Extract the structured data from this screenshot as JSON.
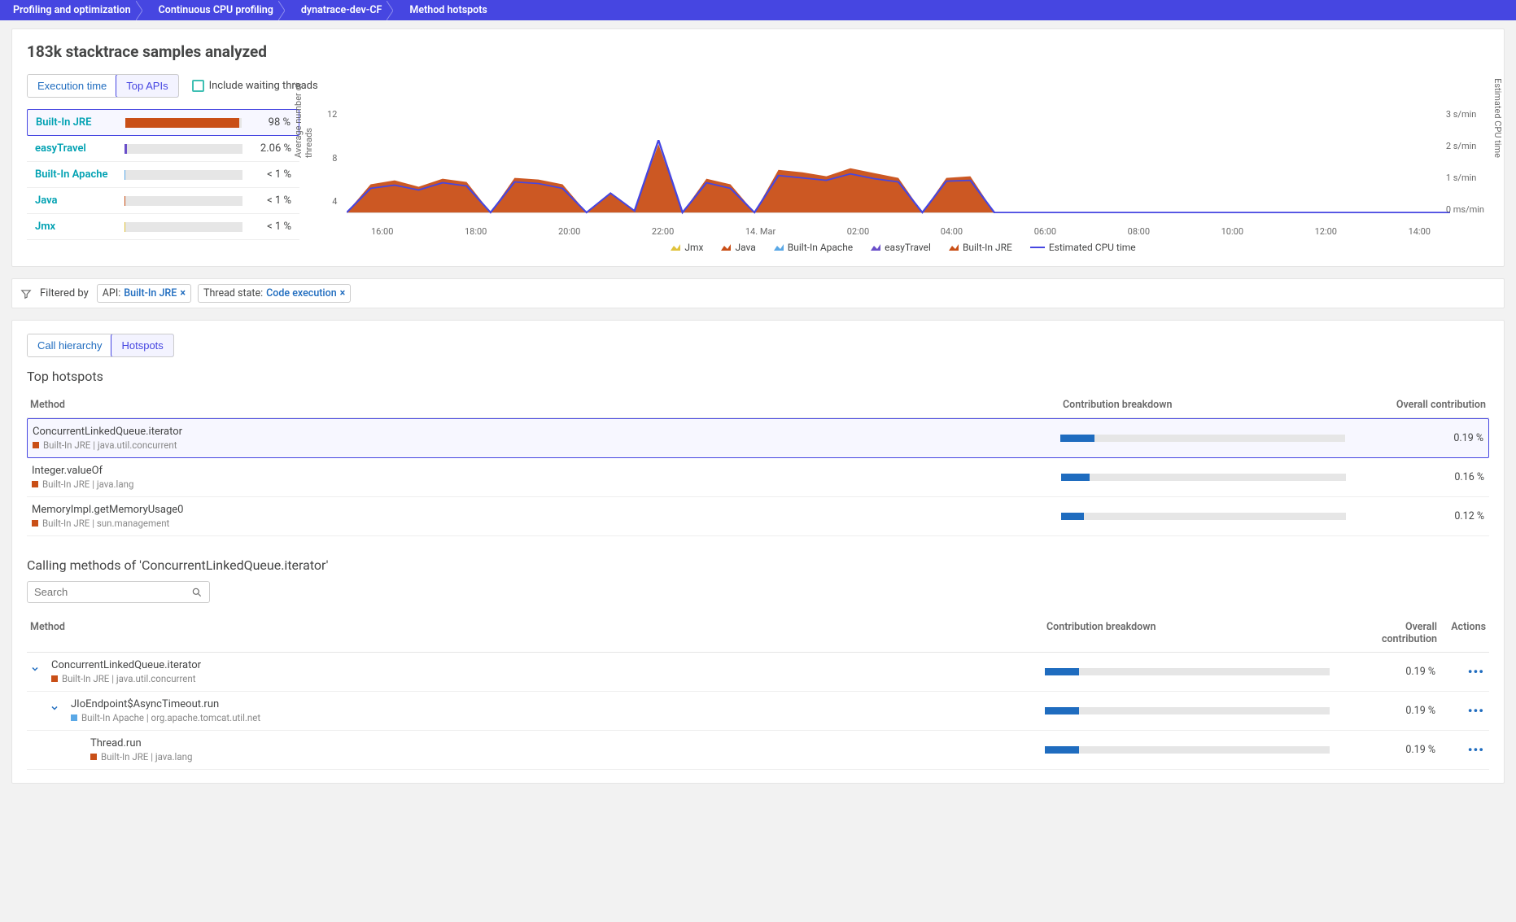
{
  "breadcrumb": {
    "items": [
      "Profiling and optimization",
      "Continuous CPU profiling",
      "dynatrace-dev-CF",
      "Method hotspots"
    ]
  },
  "headline": "183k stacktrace samples analyzed",
  "view_tabs": {
    "execution_time": "Execution time",
    "top_apis": "Top APIs"
  },
  "include_waiting_label": "Include waiting threads",
  "api_rows": [
    {
      "name": "Built-In JRE",
      "pct": "98 %",
      "width": 98,
      "color": "#c94f17"
    },
    {
      "name": "easyTravel",
      "pct": "2.06 %",
      "width": 2.06,
      "color": "#6a4fc9"
    },
    {
      "name": "Built-In Apache",
      "pct": "< 1 %",
      "width": 0.5,
      "color": "#5aa8e6"
    },
    {
      "name": "Java",
      "pct": "< 1 %",
      "width": 0.3,
      "color": "#c94f17"
    },
    {
      "name": "Jmx",
      "pct": "< 1 %",
      "width": 0.2,
      "color": "#e0c23b"
    }
  ],
  "chart_data": {
    "type": "area",
    "xlabel": "",
    "x_ticks": [
      "16:00",
      "18:00",
      "20:00",
      "22:00",
      "14. Mar",
      "02:00",
      "04:00",
      "06:00",
      "08:00",
      "10:00",
      "12:00",
      "14:00"
    ],
    "y_left_label": "Average number of\nthreads",
    "y_left_ticks": [
      "12",
      "8",
      "4"
    ],
    "y_right_label": "Estimated CPU time",
    "y_right_ticks": [
      "3 s/min",
      "2 s/min",
      "1 s/min",
      "0 ms/min"
    ],
    "series": [
      {
        "name": "Built-In JRE",
        "color": "#c94f17",
        "values": [
          0,
          3.5,
          4,
          3.2,
          4.2,
          3.8,
          0,
          4.3,
          4.1,
          3.5,
          0,
          2.5,
          0.3,
          8.5,
          0,
          4.2,
          3.5,
          0,
          5.3,
          5.0,
          4.5,
          5.5,
          4.9,
          4.3,
          0,
          4.3,
          4.5,
          0,
          0,
          0,
          0,
          0,
          0,
          0,
          0,
          0,
          0,
          0,
          0,
          0,
          0,
          0,
          0,
          0,
          0,
          0,
          0
        ]
      },
      {
        "name": "Estimated CPU time",
        "color": "#4646e1",
        "type": "line",
        "values": [
          0,
          3.0,
          3.4,
          2.8,
          3.7,
          3.3,
          0,
          3.8,
          3.6,
          3.0,
          0,
          2.4,
          0.2,
          9.0,
          0,
          3.7,
          3.0,
          0,
          4.6,
          4.3,
          4.0,
          4.8,
          4.2,
          3.8,
          0,
          3.9,
          4.0,
          0,
          0,
          0,
          0,
          0,
          0,
          0,
          0,
          0,
          0,
          0,
          0,
          0,
          0,
          0,
          0,
          0,
          0,
          0,
          0
        ]
      }
    ],
    "legend": [
      {
        "label": "Jmx",
        "color": "#e0c23b"
      },
      {
        "label": "Java",
        "color": "#c94f17"
      },
      {
        "label": "Built-In Apache",
        "color": "#5aa8e6"
      },
      {
        "label": "easyTravel",
        "color": "#6a4fc9"
      },
      {
        "label": "Built-In JRE",
        "color": "#c94f17"
      },
      {
        "label": "Estimated CPU time",
        "color": "#4646e1",
        "shape": "line"
      }
    ]
  },
  "filter_bar": {
    "label": "Filtered by",
    "chips": [
      {
        "key": "API:",
        "value": "Built-In JRE"
      },
      {
        "key": "Thread state:",
        "value": "Code execution"
      }
    ]
  },
  "lower_tabs": {
    "call_hierarchy": "Call hierarchy",
    "hotspots": "Hotspots"
  },
  "hotspots": {
    "title": "Top hotspots",
    "cols": {
      "method": "Method",
      "breakdown": "Contribution breakdown",
      "overall": "Overall contribution"
    },
    "rows": [
      {
        "name": "ConcurrentLinkedQueue.iterator",
        "sub": "Built-In JRE | java.util.concurrent",
        "sq": "#c94f17",
        "fill": 12,
        "fillColor": "#1f6cbf",
        "pct": "0.19 %",
        "selected": true
      },
      {
        "name": "Integer.valueOf",
        "sub": "Built-In JRE | java.lang",
        "sq": "#c94f17",
        "fill": 10,
        "fillColor": "#1f6cbf",
        "pct": "0.16 %"
      },
      {
        "name": "MemoryImpl.getMemoryUsage0",
        "sub": "Built-In JRE | sun.management",
        "sq": "#c94f17",
        "fill": 8,
        "fillColor": "#1f6cbf",
        "pct": "0.12 %"
      }
    ]
  },
  "calling": {
    "title_prefix": "Calling methods of '",
    "title_method": "ConcurrentLinkedQueue.iterator",
    "title_suffix": "'",
    "search_placeholder": "Search",
    "cols": {
      "method": "Method",
      "breakdown": "Contribution breakdown",
      "overall": "Overall contribution",
      "actions": "Actions"
    },
    "rows": [
      {
        "indent": 1,
        "chevron": true,
        "name": "ConcurrentLinkedQueue.iterator",
        "sub": "Built-In JRE | java.util.concurrent",
        "sq": "#c94f17",
        "fill": 12,
        "pct": "0.19 %"
      },
      {
        "indent": 2,
        "chevron": true,
        "name": "JIoEndpoint$AsyncTimeout.run",
        "sub": "Built-In Apache | org.apache.tomcat.util.net",
        "sq": "#5aa8e6",
        "fill": 12,
        "pct": "0.19 %"
      },
      {
        "indent": 3,
        "chevron": false,
        "name": "Thread.run",
        "sub": "Built-In JRE | java.lang",
        "sq": "#c94f17",
        "fill": 12,
        "pct": "0.19 %"
      }
    ]
  }
}
